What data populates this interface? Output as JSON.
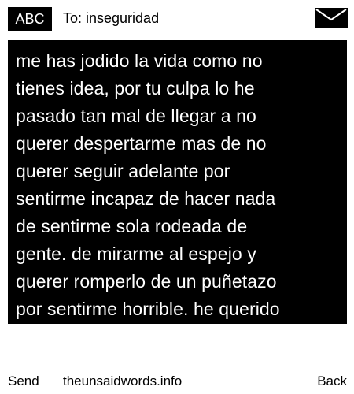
{
  "header": {
    "mode_badge": "ABC",
    "to_label": "To: inseguridad",
    "mail_icon": "envelope-icon"
  },
  "message": {
    "text": "me has jodido la vida como no\ntienes idea, por tu culpa lo he\npasado tan mal de llegar a no\nquerer despertarme mas de no\nquerer seguir adelante por\nsentirme incapaz de hacer nada\nde sentirme sola rodeada de\ngente. de mirarme al espejo y\nquerer romperlo de un puñetazo\npor sentirme horrible. he querido"
  },
  "footer": {
    "send_label": "Send",
    "site_label": "theunsaidwords.info",
    "back_label": "Back"
  },
  "colors": {
    "background": "#ffffff",
    "foreground": "#000000",
    "message_bg": "#000000",
    "message_text": "#ffffff"
  }
}
